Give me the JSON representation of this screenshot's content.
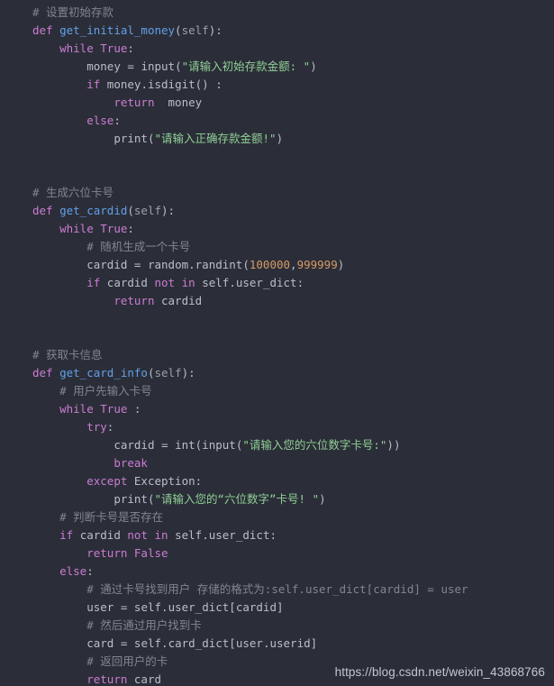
{
  "editor": {
    "background_color": "#2b2e38",
    "language": "python",
    "colors": {
      "keyword": "#cc7bd4",
      "function": "#62a0ea",
      "identifier": "#b9bfca",
      "string": "#8fce96",
      "number": "#d79a66",
      "comment": "#808691",
      "self_param": "#9aa0ab"
    }
  },
  "watermark": {
    "text": "https://blog.csdn.net/weixin_43868766"
  },
  "code": {
    "lines": [
      {
        "id": "l1",
        "indent": 0,
        "tokens": [
          {
            "t": "# 设置初始存款",
            "c": "cmt"
          }
        ]
      },
      {
        "id": "l2",
        "indent": 0,
        "tokens": [
          {
            "t": "def",
            "c": "kw"
          },
          {
            "t": " ",
            "c": "punc"
          },
          {
            "t": "get_initial_money",
            "c": "fn"
          },
          {
            "t": "(",
            "c": "punc"
          },
          {
            "t": "self",
            "c": "self"
          },
          {
            "t": "):",
            "c": "punc"
          }
        ]
      },
      {
        "id": "l3",
        "indent": 1,
        "tokens": [
          {
            "t": "while",
            "c": "kw"
          },
          {
            "t": " ",
            "c": "punc"
          },
          {
            "t": "True",
            "c": "kw"
          },
          {
            "t": ":",
            "c": "punc"
          }
        ]
      },
      {
        "id": "l4",
        "indent": 2,
        "tokens": [
          {
            "t": "money ",
            "c": "id"
          },
          {
            "t": "= ",
            "c": "punc"
          },
          {
            "t": "input",
            "c": "id"
          },
          {
            "t": "(",
            "c": "punc"
          },
          {
            "t": "\"请输入初始存款金额: \"",
            "c": "str"
          },
          {
            "t": ")",
            "c": "punc"
          }
        ]
      },
      {
        "id": "l5",
        "indent": 2,
        "tokens": [
          {
            "t": "if",
            "c": "kw"
          },
          {
            "t": " money",
            "c": "id"
          },
          {
            "t": ".",
            "c": "punc"
          },
          {
            "t": "isdigit",
            "c": "id"
          },
          {
            "t": "() :",
            "c": "punc"
          }
        ]
      },
      {
        "id": "l6",
        "indent": 3,
        "tokens": [
          {
            "t": "return",
            "c": "kw"
          },
          {
            "t": "  money",
            "c": "id"
          }
        ]
      },
      {
        "id": "l7",
        "indent": 2,
        "tokens": [
          {
            "t": "else",
            "c": "kw"
          },
          {
            "t": ":",
            "c": "punc"
          }
        ]
      },
      {
        "id": "l8",
        "indent": 3,
        "tokens": [
          {
            "t": "print",
            "c": "id"
          },
          {
            "t": "(",
            "c": "punc"
          },
          {
            "t": "\"请输入正确存款金额!\"",
            "c": "str"
          },
          {
            "t": ")",
            "c": "punc"
          }
        ]
      },
      {
        "id": "l9",
        "indent": 0,
        "tokens": []
      },
      {
        "id": "l10",
        "indent": 0,
        "tokens": []
      },
      {
        "id": "l11",
        "indent": 0,
        "tokens": [
          {
            "t": "# 生成六位卡号",
            "c": "cmt"
          }
        ]
      },
      {
        "id": "l12",
        "indent": 0,
        "tokens": [
          {
            "t": "def",
            "c": "kw"
          },
          {
            "t": " ",
            "c": "punc"
          },
          {
            "t": "get_cardid",
            "c": "fn"
          },
          {
            "t": "(",
            "c": "punc"
          },
          {
            "t": "self",
            "c": "self"
          },
          {
            "t": "):",
            "c": "punc"
          }
        ]
      },
      {
        "id": "l13",
        "indent": 1,
        "tokens": [
          {
            "t": "while",
            "c": "kw"
          },
          {
            "t": " ",
            "c": "punc"
          },
          {
            "t": "True",
            "c": "kw"
          },
          {
            "t": ":",
            "c": "punc"
          }
        ]
      },
      {
        "id": "l14",
        "indent": 2,
        "tokens": [
          {
            "t": "# 随机生成一个卡号",
            "c": "cmt"
          }
        ]
      },
      {
        "id": "l15",
        "indent": 2,
        "tokens": [
          {
            "t": "cardid ",
            "c": "id"
          },
          {
            "t": "= ",
            "c": "punc"
          },
          {
            "t": "random",
            "c": "id"
          },
          {
            "t": ".",
            "c": "punc"
          },
          {
            "t": "randint",
            "c": "id"
          },
          {
            "t": "(",
            "c": "punc"
          },
          {
            "t": "100000",
            "c": "num"
          },
          {
            "t": ",",
            "c": "punc"
          },
          {
            "t": "999999",
            "c": "num"
          },
          {
            "t": ")",
            "c": "punc"
          }
        ]
      },
      {
        "id": "l16",
        "indent": 2,
        "tokens": [
          {
            "t": "if",
            "c": "kw"
          },
          {
            "t": " cardid ",
            "c": "id"
          },
          {
            "t": "not",
            "c": "kw"
          },
          {
            "t": " ",
            "c": "punc"
          },
          {
            "t": "in",
            "c": "kw"
          },
          {
            "t": " self",
            "c": "id"
          },
          {
            "t": ".",
            "c": "punc"
          },
          {
            "t": "user_dict",
            "c": "id"
          },
          {
            "t": ":",
            "c": "punc"
          }
        ]
      },
      {
        "id": "l17",
        "indent": 3,
        "tokens": [
          {
            "t": "return",
            "c": "kw"
          },
          {
            "t": " cardid",
            "c": "id"
          }
        ]
      },
      {
        "id": "l18",
        "indent": 0,
        "tokens": []
      },
      {
        "id": "l19",
        "indent": 0,
        "tokens": []
      },
      {
        "id": "l20",
        "indent": 0,
        "tokens": [
          {
            "t": "# 获取卡信息",
            "c": "cmt"
          }
        ]
      },
      {
        "id": "l21",
        "indent": 0,
        "tokens": [
          {
            "t": "def",
            "c": "kw"
          },
          {
            "t": " ",
            "c": "punc"
          },
          {
            "t": "get_card_info",
            "c": "fn"
          },
          {
            "t": "(",
            "c": "punc"
          },
          {
            "t": "self",
            "c": "self"
          },
          {
            "t": "):",
            "c": "punc"
          }
        ]
      },
      {
        "id": "l22",
        "indent": 1,
        "tokens": [
          {
            "t": "# 用户先输入卡号",
            "c": "cmt"
          }
        ]
      },
      {
        "id": "l23",
        "indent": 1,
        "tokens": [
          {
            "t": "while",
            "c": "kw"
          },
          {
            "t": " ",
            "c": "punc"
          },
          {
            "t": "True",
            "c": "kw"
          },
          {
            "t": " :",
            "c": "punc"
          }
        ]
      },
      {
        "id": "l24",
        "indent": 2,
        "tokens": [
          {
            "t": "try",
            "c": "kw"
          },
          {
            "t": ":",
            "c": "punc"
          }
        ]
      },
      {
        "id": "l25",
        "indent": 3,
        "tokens": [
          {
            "t": "cardid ",
            "c": "id"
          },
          {
            "t": "= ",
            "c": "punc"
          },
          {
            "t": "int",
            "c": "id"
          },
          {
            "t": "(",
            "c": "punc"
          },
          {
            "t": "input",
            "c": "id"
          },
          {
            "t": "(",
            "c": "punc"
          },
          {
            "t": "\"请输入您的六位数字卡号:\"",
            "c": "str"
          },
          {
            "t": "))",
            "c": "punc"
          }
        ]
      },
      {
        "id": "l26",
        "indent": 3,
        "tokens": [
          {
            "t": "break",
            "c": "kw"
          }
        ]
      },
      {
        "id": "l27",
        "indent": 2,
        "tokens": [
          {
            "t": "except",
            "c": "kw"
          },
          {
            "t": " ",
            "c": "punc"
          },
          {
            "t": "Exception",
            "c": "id"
          },
          {
            "t": ":",
            "c": "punc"
          }
        ]
      },
      {
        "id": "l28",
        "indent": 3,
        "tokens": [
          {
            "t": "print",
            "c": "id"
          },
          {
            "t": "(",
            "c": "punc"
          },
          {
            "t": "\"请输入您的“六位数字”卡号! \"",
            "c": "str"
          },
          {
            "t": ")",
            "c": "punc"
          }
        ]
      },
      {
        "id": "l29",
        "indent": 1,
        "tokens": [
          {
            "t": "# 判断卡号是否存在",
            "c": "cmt"
          }
        ]
      },
      {
        "id": "l30",
        "indent": 1,
        "tokens": [
          {
            "t": "if",
            "c": "kw"
          },
          {
            "t": " cardid ",
            "c": "id"
          },
          {
            "t": "not",
            "c": "kw"
          },
          {
            "t": " ",
            "c": "punc"
          },
          {
            "t": "in",
            "c": "kw"
          },
          {
            "t": " self",
            "c": "id"
          },
          {
            "t": ".",
            "c": "punc"
          },
          {
            "t": "user_dict",
            "c": "id"
          },
          {
            "t": ":",
            "c": "punc"
          }
        ]
      },
      {
        "id": "l31",
        "indent": 2,
        "tokens": [
          {
            "t": "return",
            "c": "kw"
          },
          {
            "t": " ",
            "c": "punc"
          },
          {
            "t": "False",
            "c": "kw"
          }
        ]
      },
      {
        "id": "l32",
        "indent": 1,
        "tokens": [
          {
            "t": "else",
            "c": "kw"
          },
          {
            "t": ":",
            "c": "punc"
          }
        ]
      },
      {
        "id": "l33",
        "indent": 2,
        "tokens": [
          {
            "t": "# 通过卡号找到用户 存储的格式为:self.user_dict[cardid] = user",
            "c": "cmt"
          }
        ]
      },
      {
        "id": "l34",
        "indent": 2,
        "tokens": [
          {
            "t": "user ",
            "c": "id"
          },
          {
            "t": "= ",
            "c": "punc"
          },
          {
            "t": "self",
            "c": "id"
          },
          {
            "t": ".",
            "c": "punc"
          },
          {
            "t": "user_dict",
            "c": "id"
          },
          {
            "t": "[",
            "c": "punc"
          },
          {
            "t": "cardid",
            "c": "id"
          },
          {
            "t": "]",
            "c": "punc"
          }
        ]
      },
      {
        "id": "l35",
        "indent": 2,
        "tokens": [
          {
            "t": "# 然后通过用户找到卡",
            "c": "cmt"
          }
        ]
      },
      {
        "id": "l36",
        "indent": 2,
        "tokens": [
          {
            "t": "card ",
            "c": "id"
          },
          {
            "t": "= ",
            "c": "punc"
          },
          {
            "t": "self",
            "c": "id"
          },
          {
            "t": ".",
            "c": "punc"
          },
          {
            "t": "card_dict",
            "c": "id"
          },
          {
            "t": "[",
            "c": "punc"
          },
          {
            "t": "user",
            "c": "id"
          },
          {
            "t": ".",
            "c": "punc"
          },
          {
            "t": "userid",
            "c": "id"
          },
          {
            "t": "]",
            "c": "punc"
          }
        ]
      },
      {
        "id": "l37",
        "indent": 2,
        "tokens": [
          {
            "t": "# 返回用户的卡",
            "c": "cmt"
          }
        ]
      },
      {
        "id": "l38",
        "indent": 2,
        "tokens": [
          {
            "t": "return",
            "c": "kw"
          },
          {
            "t": " card",
            "c": "id"
          }
        ]
      }
    ]
  }
}
